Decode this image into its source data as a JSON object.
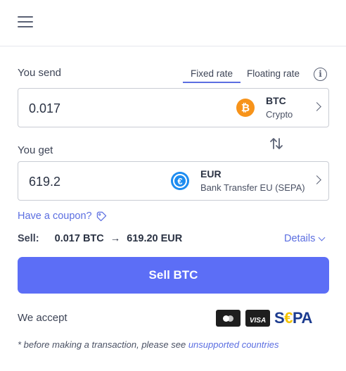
{
  "header": {
    "menu_icon": "hamburger-menu-icon"
  },
  "send": {
    "label": "You send",
    "amount": "0.017",
    "currency_code": "BTC",
    "currency_sub": "Crypto",
    "coin_symbol": "₿",
    "coin_color": "#f7931a"
  },
  "rate_tabs": {
    "fixed": "Fixed rate",
    "floating": "Floating rate",
    "active": "fixed",
    "info_icon_glyph": "i"
  },
  "get": {
    "label": "You get",
    "amount": "619.2",
    "currency_code": "EUR",
    "currency_sub": "Bank Transfer EU (SEPA)",
    "coin_symbol": "€",
    "coin_color": "#1d8cf0"
  },
  "coupon": {
    "label": "Have a coupon?"
  },
  "summary": {
    "key": "Sell:",
    "from": "0.017 BTC",
    "arrow": "→",
    "to": "619.20 EUR",
    "details_label": "Details"
  },
  "sell_button": {
    "label": "Sell BTC",
    "color": "#5c6ef6"
  },
  "payments": {
    "label": "We accept",
    "visa": "VISA",
    "sepa_s": "S",
    "sepa_e": "€",
    "sepa_pa": "PA"
  },
  "footnote": {
    "text": "* before making a transaction, please see ",
    "link": "unsupported countries"
  },
  "colors": {
    "accent": "#5b6ee1",
    "border": "#c9ccd4"
  }
}
